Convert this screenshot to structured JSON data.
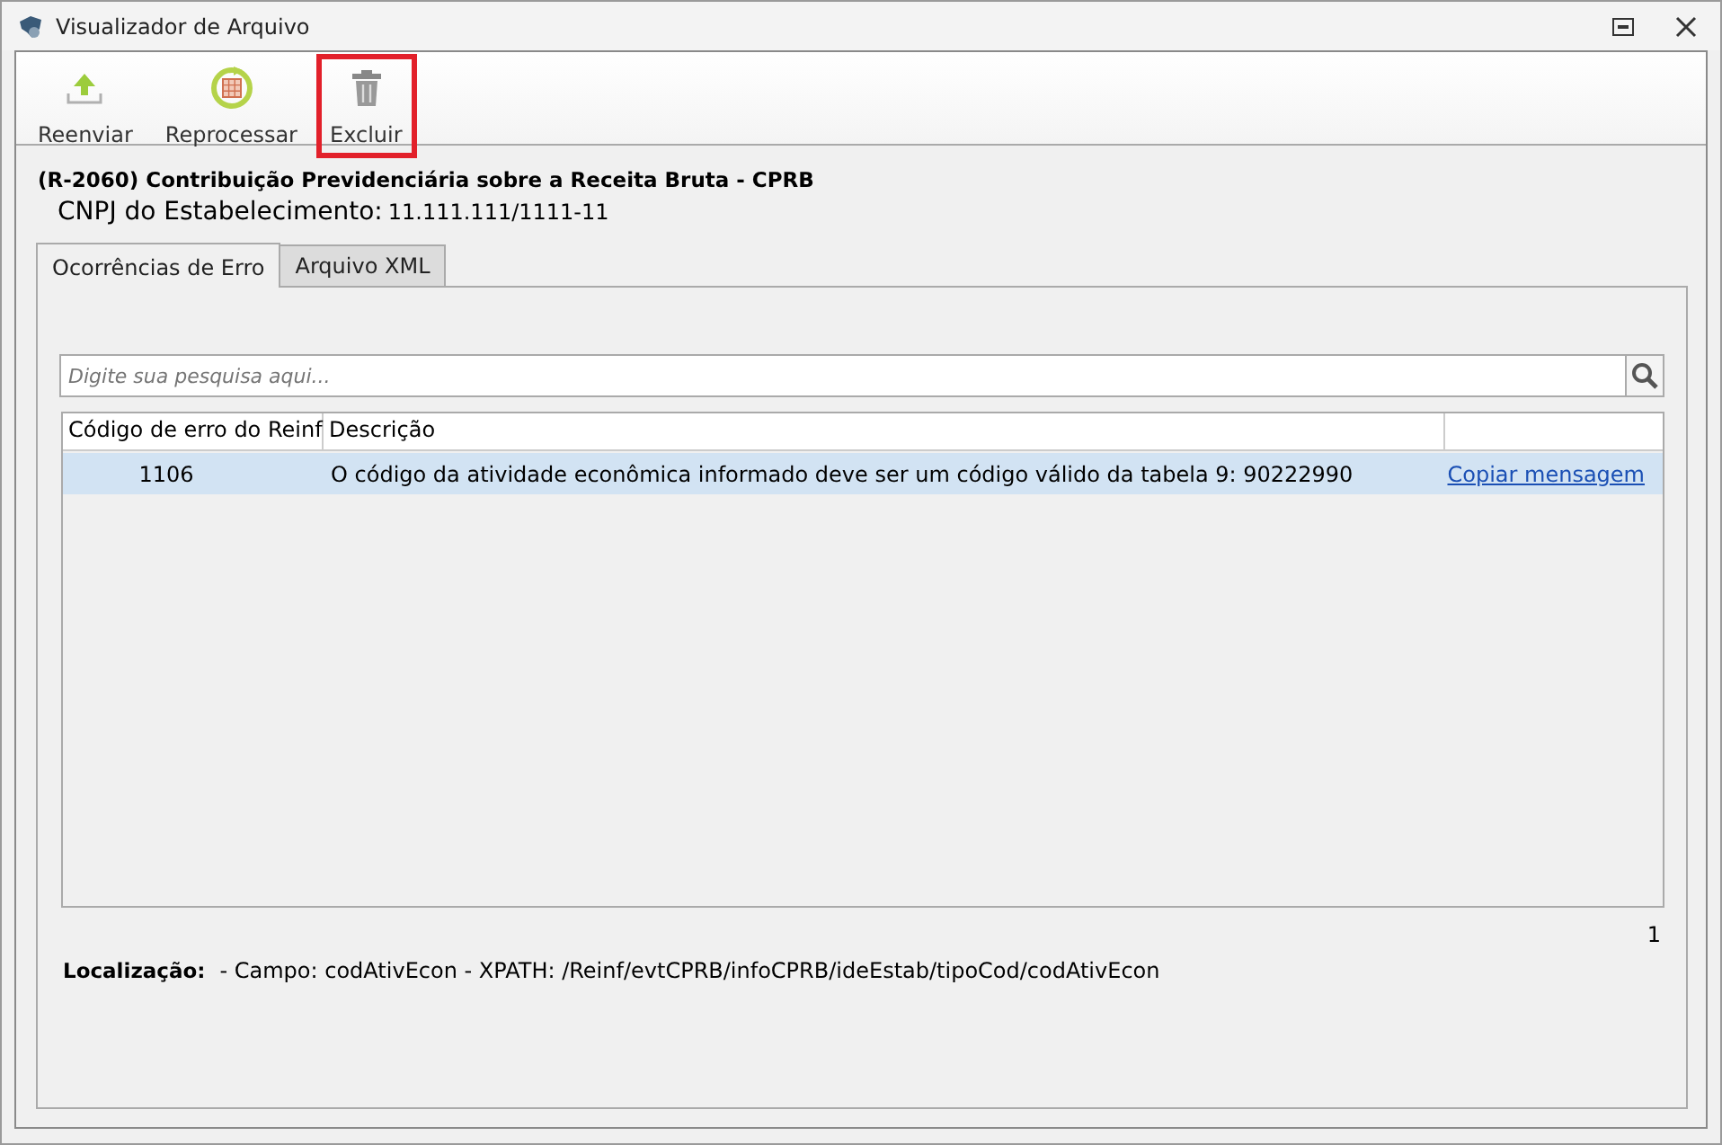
{
  "window": {
    "title": "Visualizador de Arquivo"
  },
  "toolbar": [
    {
      "label": "Reenviar",
      "kind": "upload",
      "highlighted": false
    },
    {
      "label": "Reprocessar",
      "kind": "reprocess",
      "highlighted": false
    },
    {
      "label": "Excluir",
      "kind": "delete",
      "highlighted": true
    }
  ],
  "heading": "(R-2060) Contribuição Previdenciária sobre a Receita Bruta - CPRB",
  "cnpj": {
    "label": "CNPJ do Estabelecimento:",
    "value": "11.111.111/1111-11"
  },
  "tabs": [
    {
      "label": "Ocorrências de Erro",
      "selected": true
    },
    {
      "label": "Arquivo XML",
      "selected": false
    }
  ],
  "search": {
    "placeholder": "Digite sua pesquisa aqui..."
  },
  "table": {
    "columns": [
      "Código de erro do Reinf",
      "Descrição"
    ],
    "rows": [
      {
        "code": "1106",
        "description": "O código da atividade econômica informado deve ser um código válido da tabela 9: 90222990",
        "link": "Copiar mensagem",
        "selected": true
      }
    ]
  },
  "count": "1",
  "location": {
    "label": "Localização:",
    "value": "- Campo: codAtivEcon - XPATH: /Reinf/evtCPRB/infoCPRB/ideEstab/tipoCod/codAtivEcon"
  }
}
